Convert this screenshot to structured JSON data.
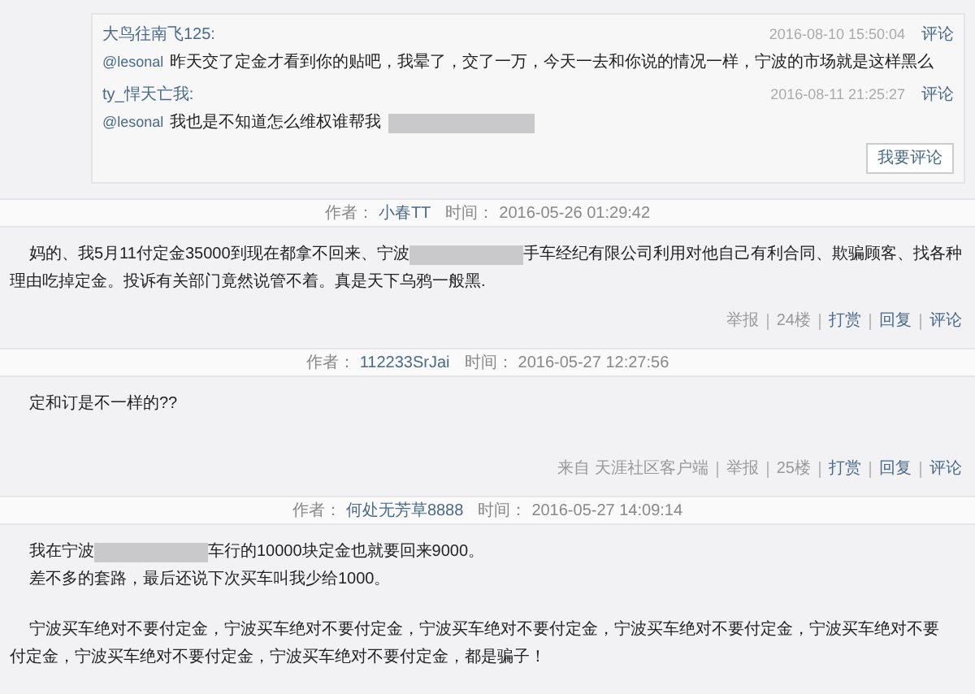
{
  "comments": [
    {
      "user": "大鸟往南飞125:",
      "time": "2016-08-10 15:50:04",
      "action": "评论",
      "mention": "@lesonal",
      "text": "昨天交了定金才看到你的贴吧，我晕了，交了一万，今天一去和你说的情况一样，宁波的市场就是这样黑么",
      "redacted": false
    },
    {
      "user": "ty_悍天亡我:",
      "time": "2016-08-11 21:25:27",
      "action": "评论",
      "mention": "@lesonal",
      "text": "我也是不知道怎么维权谁帮我",
      "redacted": true
    }
  ],
  "comment_button": "我要评论",
  "posts": [
    {
      "author_label": "作者：",
      "author": "小春TT",
      "time_label": "时间：",
      "time": "2016-05-26 01:29:42",
      "paragraphs": [
        {
          "lines": [
            {
              "before": "妈的、我5月11付定金35000到现在都拿不回来、宁波",
              "redacted": true,
              "after": "手车经纪有限公司利用对他自己有利合同、欺骗顾客、找各种",
              "indent": true
            },
            {
              "before": "理由吃掉定金。投诉有关部门竟然说管不着。真是天下乌鸦一般黑.",
              "redacted": false,
              "indent": false
            }
          ]
        }
      ],
      "footer": [
        {
          "text": "举报",
          "kind": "plain"
        },
        {
          "text": "24楼",
          "kind": "plain"
        },
        {
          "text": "打赏",
          "kind": "link"
        },
        {
          "text": "回复",
          "kind": "link"
        },
        {
          "text": "评论",
          "kind": "link"
        }
      ]
    },
    {
      "author_label": "作者：",
      "author": "112233SrJai",
      "time_label": "时间：",
      "time": "2016-05-27 12:27:56",
      "paragraphs": [
        {
          "lines": [
            {
              "before": "定和订是不一样的??",
              "redacted": false,
              "indent": true
            }
          ]
        }
      ],
      "footer": [
        {
          "text": "来自 天涯社区客户端",
          "kind": "plain"
        },
        {
          "text": "举报",
          "kind": "plain"
        },
        {
          "text": "25楼",
          "kind": "plain"
        },
        {
          "text": "打赏",
          "kind": "link"
        },
        {
          "text": "回复",
          "kind": "link"
        },
        {
          "text": "评论",
          "kind": "link"
        }
      ]
    },
    {
      "author_label": "作者：",
      "author": "何处无芳草8888",
      "time_label": "时间：",
      "time": "2016-05-27 14:09:14",
      "paragraphs": [
        {
          "lines": [
            {
              "before": "我在宁波",
              "redacted": true,
              "after": "车行的10000块定金也就要回来9000。",
              "indent": true
            },
            {
              "before": "差不多的套路，最后还说下次买车叫我少给1000。",
              "redacted": false,
              "indent": true
            }
          ]
        },
        {
          "lines": [
            {
              "before": "宁波买车绝对不要付定金，宁波买车绝对不要付定金，宁波买车绝对不要付定金，宁波买车绝对不要付定金，宁波买车绝对不要",
              "redacted": false,
              "indent": true
            },
            {
              "before": "付定金，宁波买车绝对不要付定金，宁波买车绝对不要付定金，都是骗子！",
              "redacted": false,
              "indent": false
            }
          ]
        }
      ]
    }
  ]
}
